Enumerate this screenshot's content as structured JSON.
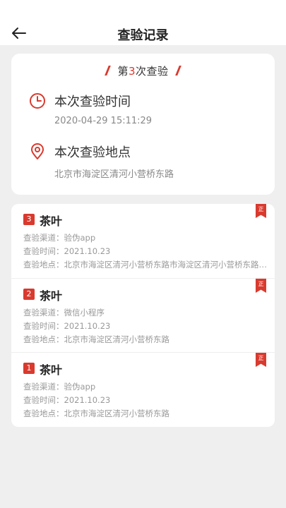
{
  "header": {
    "title": "查验记录",
    "back_icon": "arrow-left-icon"
  },
  "summary": {
    "count_prefix": "第",
    "count_num": "3",
    "count_suffix": "次查验",
    "time_label": "本次查验时间",
    "time_value": "2020-04-29 15:11:29",
    "location_label": "本次查验地点",
    "location_value": "北京市海淀区清河小营桥东路"
  },
  "records": [
    {
      "index": "3",
      "title": "茶叶",
      "badge": "正",
      "channel": "查验渠道：验伪app",
      "time": "查验时间：2021.10.23",
      "place": "查验地点：北京市海淀区清河小营桥东路市海淀区清河小营桥东路…"
    },
    {
      "index": "2",
      "title": "茶叶",
      "badge": "正",
      "channel": "查验渠道：微信小程序",
      "time": "查验时间：2021.10.23",
      "place": "查验地点：北京市海淀区清河小营桥东路"
    },
    {
      "index": "1",
      "title": "茶叶",
      "badge": "正",
      "channel": "查验渠道：验伪app",
      "time": "查验时间：2021.10.23",
      "place": "查验地点：北京市海淀区清河小营桥东路"
    }
  ],
  "colors": {
    "accent": "#d93a2e",
    "background": "#efefef"
  }
}
